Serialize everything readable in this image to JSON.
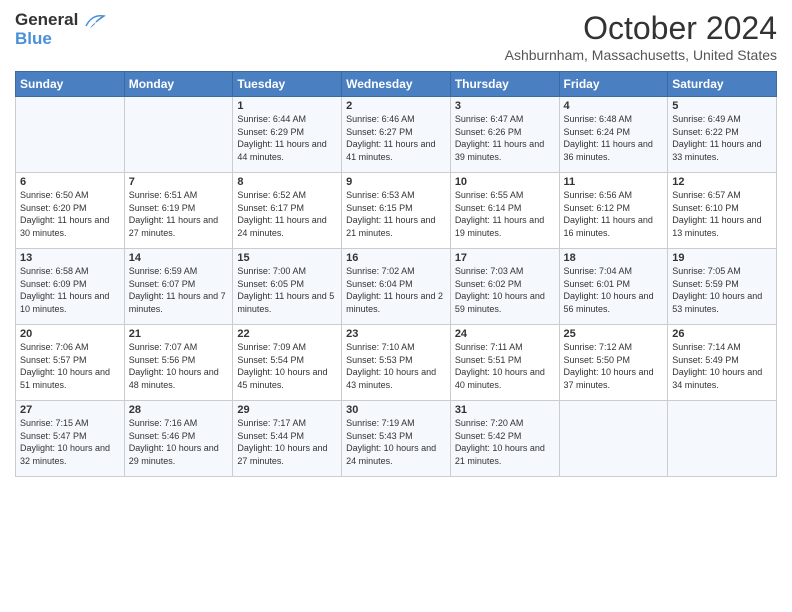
{
  "logo": {
    "line1": "General",
    "line2": "Blue"
  },
  "header": {
    "month": "October 2024",
    "location": "Ashburnham, Massachusetts, United States"
  },
  "days_of_week": [
    "Sunday",
    "Monday",
    "Tuesday",
    "Wednesday",
    "Thursday",
    "Friday",
    "Saturday"
  ],
  "weeks": [
    [
      {
        "day": "",
        "sunrise": "",
        "sunset": "",
        "daylight": ""
      },
      {
        "day": "",
        "sunrise": "",
        "sunset": "",
        "daylight": ""
      },
      {
        "day": "1",
        "sunrise": "Sunrise: 6:44 AM",
        "sunset": "Sunset: 6:29 PM",
        "daylight": "Daylight: 11 hours and 44 minutes."
      },
      {
        "day": "2",
        "sunrise": "Sunrise: 6:46 AM",
        "sunset": "Sunset: 6:27 PM",
        "daylight": "Daylight: 11 hours and 41 minutes."
      },
      {
        "day": "3",
        "sunrise": "Sunrise: 6:47 AM",
        "sunset": "Sunset: 6:26 PM",
        "daylight": "Daylight: 11 hours and 39 minutes."
      },
      {
        "day": "4",
        "sunrise": "Sunrise: 6:48 AM",
        "sunset": "Sunset: 6:24 PM",
        "daylight": "Daylight: 11 hours and 36 minutes."
      },
      {
        "day": "5",
        "sunrise": "Sunrise: 6:49 AM",
        "sunset": "Sunset: 6:22 PM",
        "daylight": "Daylight: 11 hours and 33 minutes."
      }
    ],
    [
      {
        "day": "6",
        "sunrise": "Sunrise: 6:50 AM",
        "sunset": "Sunset: 6:20 PM",
        "daylight": "Daylight: 11 hours and 30 minutes."
      },
      {
        "day": "7",
        "sunrise": "Sunrise: 6:51 AM",
        "sunset": "Sunset: 6:19 PM",
        "daylight": "Daylight: 11 hours and 27 minutes."
      },
      {
        "day": "8",
        "sunrise": "Sunrise: 6:52 AM",
        "sunset": "Sunset: 6:17 PM",
        "daylight": "Daylight: 11 hours and 24 minutes."
      },
      {
        "day": "9",
        "sunrise": "Sunrise: 6:53 AM",
        "sunset": "Sunset: 6:15 PM",
        "daylight": "Daylight: 11 hours and 21 minutes."
      },
      {
        "day": "10",
        "sunrise": "Sunrise: 6:55 AM",
        "sunset": "Sunset: 6:14 PM",
        "daylight": "Daylight: 11 hours and 19 minutes."
      },
      {
        "day": "11",
        "sunrise": "Sunrise: 6:56 AM",
        "sunset": "Sunset: 6:12 PM",
        "daylight": "Daylight: 11 hours and 16 minutes."
      },
      {
        "day": "12",
        "sunrise": "Sunrise: 6:57 AM",
        "sunset": "Sunset: 6:10 PM",
        "daylight": "Daylight: 11 hours and 13 minutes."
      }
    ],
    [
      {
        "day": "13",
        "sunrise": "Sunrise: 6:58 AM",
        "sunset": "Sunset: 6:09 PM",
        "daylight": "Daylight: 11 hours and 10 minutes."
      },
      {
        "day": "14",
        "sunrise": "Sunrise: 6:59 AM",
        "sunset": "Sunset: 6:07 PM",
        "daylight": "Daylight: 11 hours and 7 minutes."
      },
      {
        "day": "15",
        "sunrise": "Sunrise: 7:00 AM",
        "sunset": "Sunset: 6:05 PM",
        "daylight": "Daylight: 11 hours and 5 minutes."
      },
      {
        "day": "16",
        "sunrise": "Sunrise: 7:02 AM",
        "sunset": "Sunset: 6:04 PM",
        "daylight": "Daylight: 11 hours and 2 minutes."
      },
      {
        "day": "17",
        "sunrise": "Sunrise: 7:03 AM",
        "sunset": "Sunset: 6:02 PM",
        "daylight": "Daylight: 10 hours and 59 minutes."
      },
      {
        "day": "18",
        "sunrise": "Sunrise: 7:04 AM",
        "sunset": "Sunset: 6:01 PM",
        "daylight": "Daylight: 10 hours and 56 minutes."
      },
      {
        "day": "19",
        "sunrise": "Sunrise: 7:05 AM",
        "sunset": "Sunset: 5:59 PM",
        "daylight": "Daylight: 10 hours and 53 minutes."
      }
    ],
    [
      {
        "day": "20",
        "sunrise": "Sunrise: 7:06 AM",
        "sunset": "Sunset: 5:57 PM",
        "daylight": "Daylight: 10 hours and 51 minutes."
      },
      {
        "day": "21",
        "sunrise": "Sunrise: 7:07 AM",
        "sunset": "Sunset: 5:56 PM",
        "daylight": "Daylight: 10 hours and 48 minutes."
      },
      {
        "day": "22",
        "sunrise": "Sunrise: 7:09 AM",
        "sunset": "Sunset: 5:54 PM",
        "daylight": "Daylight: 10 hours and 45 minutes."
      },
      {
        "day": "23",
        "sunrise": "Sunrise: 7:10 AM",
        "sunset": "Sunset: 5:53 PM",
        "daylight": "Daylight: 10 hours and 43 minutes."
      },
      {
        "day": "24",
        "sunrise": "Sunrise: 7:11 AM",
        "sunset": "Sunset: 5:51 PM",
        "daylight": "Daylight: 10 hours and 40 minutes."
      },
      {
        "day": "25",
        "sunrise": "Sunrise: 7:12 AM",
        "sunset": "Sunset: 5:50 PM",
        "daylight": "Daylight: 10 hours and 37 minutes."
      },
      {
        "day": "26",
        "sunrise": "Sunrise: 7:14 AM",
        "sunset": "Sunset: 5:49 PM",
        "daylight": "Daylight: 10 hours and 34 minutes."
      }
    ],
    [
      {
        "day": "27",
        "sunrise": "Sunrise: 7:15 AM",
        "sunset": "Sunset: 5:47 PM",
        "daylight": "Daylight: 10 hours and 32 minutes."
      },
      {
        "day": "28",
        "sunrise": "Sunrise: 7:16 AM",
        "sunset": "Sunset: 5:46 PM",
        "daylight": "Daylight: 10 hours and 29 minutes."
      },
      {
        "day": "29",
        "sunrise": "Sunrise: 7:17 AM",
        "sunset": "Sunset: 5:44 PM",
        "daylight": "Daylight: 10 hours and 27 minutes."
      },
      {
        "day": "30",
        "sunrise": "Sunrise: 7:19 AM",
        "sunset": "Sunset: 5:43 PM",
        "daylight": "Daylight: 10 hours and 24 minutes."
      },
      {
        "day": "31",
        "sunrise": "Sunrise: 7:20 AM",
        "sunset": "Sunset: 5:42 PM",
        "daylight": "Daylight: 10 hours and 21 minutes."
      },
      {
        "day": "",
        "sunrise": "",
        "sunset": "",
        "daylight": ""
      },
      {
        "day": "",
        "sunrise": "",
        "sunset": "",
        "daylight": ""
      }
    ]
  ]
}
